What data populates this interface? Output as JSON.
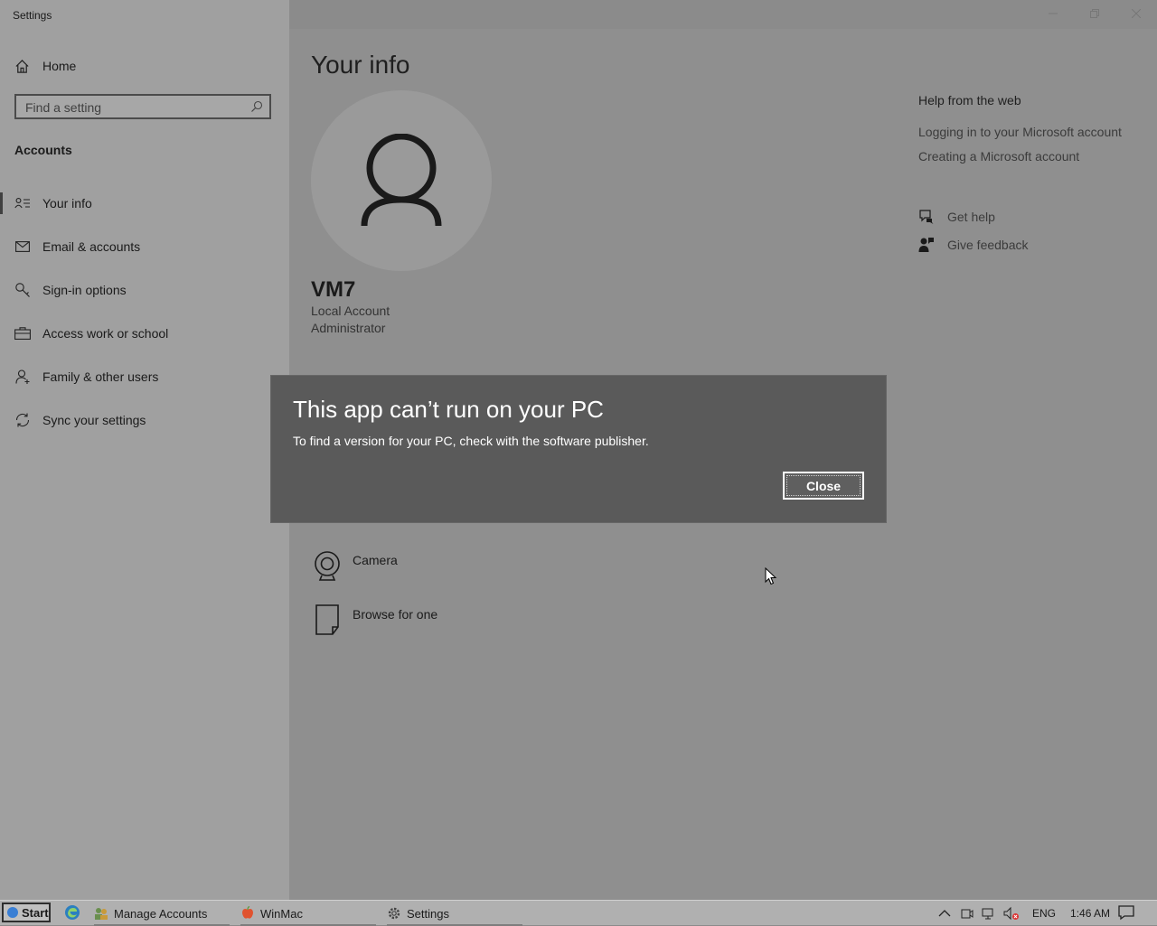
{
  "window": {
    "title": "Settings",
    "minimize_icon": "minimize-icon",
    "maximize_icon": "restore-icon",
    "close_icon": "close-icon"
  },
  "sidebar": {
    "home_label": "Home",
    "search_placeholder": "Find a setting",
    "section_title": "Accounts",
    "items": [
      {
        "label": "Your info",
        "icon": "contact-card-icon",
        "selected": true
      },
      {
        "label": "Email & accounts",
        "icon": "mail-icon",
        "selected": false
      },
      {
        "label": "Sign-in options",
        "icon": "key-icon",
        "selected": false
      },
      {
        "label": "Access work or school",
        "icon": "briefcase-icon",
        "selected": false
      },
      {
        "label": "Family & other users",
        "icon": "person-add-icon",
        "selected": false
      },
      {
        "label": "Sync your settings",
        "icon": "sync-icon",
        "selected": false
      }
    ]
  },
  "main": {
    "page_title": "Your info",
    "user": {
      "name": "VM7",
      "account_type": "Local Account",
      "role": "Administrator"
    },
    "create_picture": [
      {
        "label": "Camera",
        "icon": "camera-icon"
      },
      {
        "label": "Browse for one",
        "icon": "file-icon"
      }
    ]
  },
  "help": {
    "heading": "Help from the web",
    "links": [
      "Logging in to your Microsoft account",
      "Creating a Microsoft account"
    ],
    "get_help": "Get help",
    "give_feedback": "Give feedback"
  },
  "dialog": {
    "title": "This app can’t run on your PC",
    "message": "To find a version for your PC, check with the software publisher.",
    "close_button": "Close"
  },
  "taskbar": {
    "start_label": "Start",
    "tasks": [
      "Manage Accounts",
      "WinMac",
      "Settings"
    ],
    "language": "ENG",
    "time": "1:46 AM"
  },
  "colors": {
    "dialog_bg": "#5a5a5a",
    "sidebar_bg": "#a0a0a0",
    "main_bg": "#8f8f8f",
    "start_accent": "#3a7fd4"
  }
}
